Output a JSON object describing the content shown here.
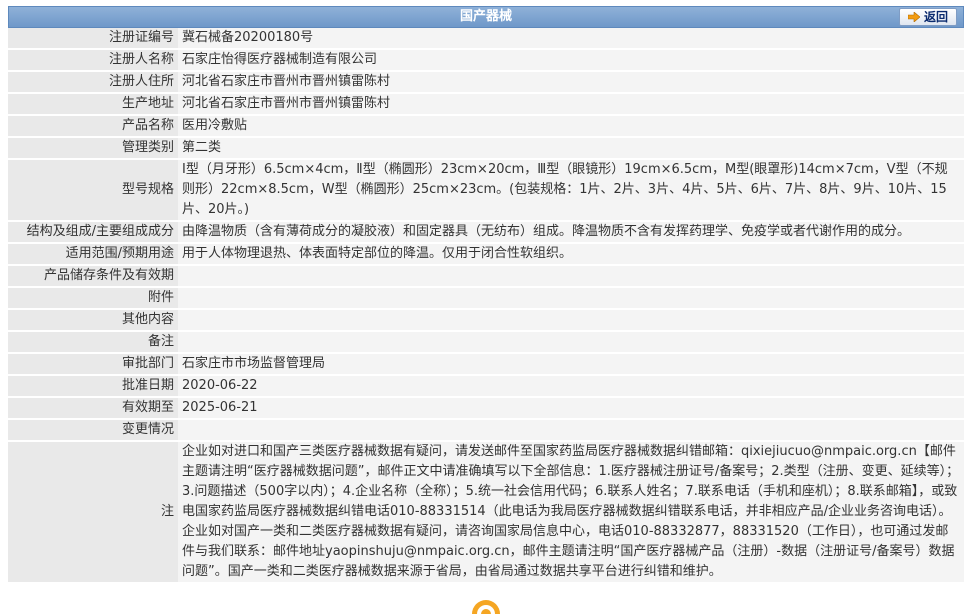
{
  "header": {
    "title": "国产器械",
    "back_label": "返回"
  },
  "rows": [
    {
      "label": "注册证编号",
      "value": "冀石械备20200180号"
    },
    {
      "label": "注册人名称",
      "value": "石家庄怡得医疗器械制造有限公司"
    },
    {
      "label": "注册人住所",
      "value": "河北省石家庄市晋州市晋州镇雷陈村"
    },
    {
      "label": "生产地址",
      "value": "河北省石家庄市晋州市晋州镇雷陈村"
    },
    {
      "label": "产品名称",
      "value": "医用冷敷贴"
    },
    {
      "label": "管理类别",
      "value": "第二类"
    },
    {
      "label": "型号规格",
      "value": "Ⅰ型（月牙形）6.5cm×4cm，Ⅱ型（椭圆形）23cm×20cm，Ⅲ型（眼镜形）19cm×6.5cm，M型(眼罩形)14cm×7cm，V型（不规则形）22cm×8.5cm，W型（椭圆形）25cm×23cm。(包装规格：1片、2片、3片、4片、5片、6片、7片、8片、9片、10片、15片、20片。)"
    },
    {
      "label": "结构及组成/主要组成成分",
      "value": "由降温物质（含有薄荷成分的凝胶液）和固定器具（无纺布）组成。降温物质不含有发挥药理学、免疫学或者代谢作用的成分。"
    },
    {
      "label": "适用范围/预期用途",
      "value": "用于人体物理退热、体表面特定部位的降温。仅用于闭合性软组织。"
    },
    {
      "label": "产品储存条件及有效期",
      "value": ""
    },
    {
      "label": "附件",
      "value": ""
    },
    {
      "label": "其他内容",
      "value": ""
    },
    {
      "label": "备注",
      "value": ""
    },
    {
      "label": "审批部门",
      "value": "石家庄市市场监督管理局"
    },
    {
      "label": "批准日期",
      "value": "2020-06-22"
    },
    {
      "label": "有效期至",
      "value": "2025-06-21"
    },
    {
      "label": "变更情况",
      "value": ""
    }
  ],
  "note": {
    "label": "注",
    "value": "企业如对进口和国产三类医疗器械数据有疑问，请发送邮件至国家药监局医疗器械数据纠错邮箱：qixiejiucuo@nmpaic.org.cn【邮件主题请注明“医疗器械数据问题”，邮件正文中请准确填写以下全部信息：1.医疗器械注册证号/备案号；2.类型（注册、变更、延续等）；3.问题描述（500字以内）；4.企业名称（全称）；5.统一社会信用代码；6.联系人姓名；7.联系电话（手机和座机）；8.联系邮箱】，或致电国家药监局医疗器械数据纠错电话010-88331514（此电话为我局医疗器械数据纠错联系电话，并非相应产品/企业业务咨询电话）。企业如对国产一类和二类医疗器械数据有疑问，请咨询国家局信息中心，电话010-88332877，88331520（工作日），也可通过发邮件与我们联系：邮件地址yaopinshuju@nmpaic.org.cn，邮件主题请注明“国产医疗器械产品（注册）-数据（注册证号/备案号）数据问题”。国产一类和二类医疗器械数据来源于省局，由省局通过数据共享平台进行纠错和维护。"
  },
  "colors": {
    "header_bg": "#7ba3d1",
    "label_bg": "#e9e9e9",
    "value_bg": "#f4f4f4",
    "accent_arrow": "#f39c12"
  },
  "icons": {
    "back": "arrow-right-icon",
    "bottom": "partial-logo-icon"
  }
}
